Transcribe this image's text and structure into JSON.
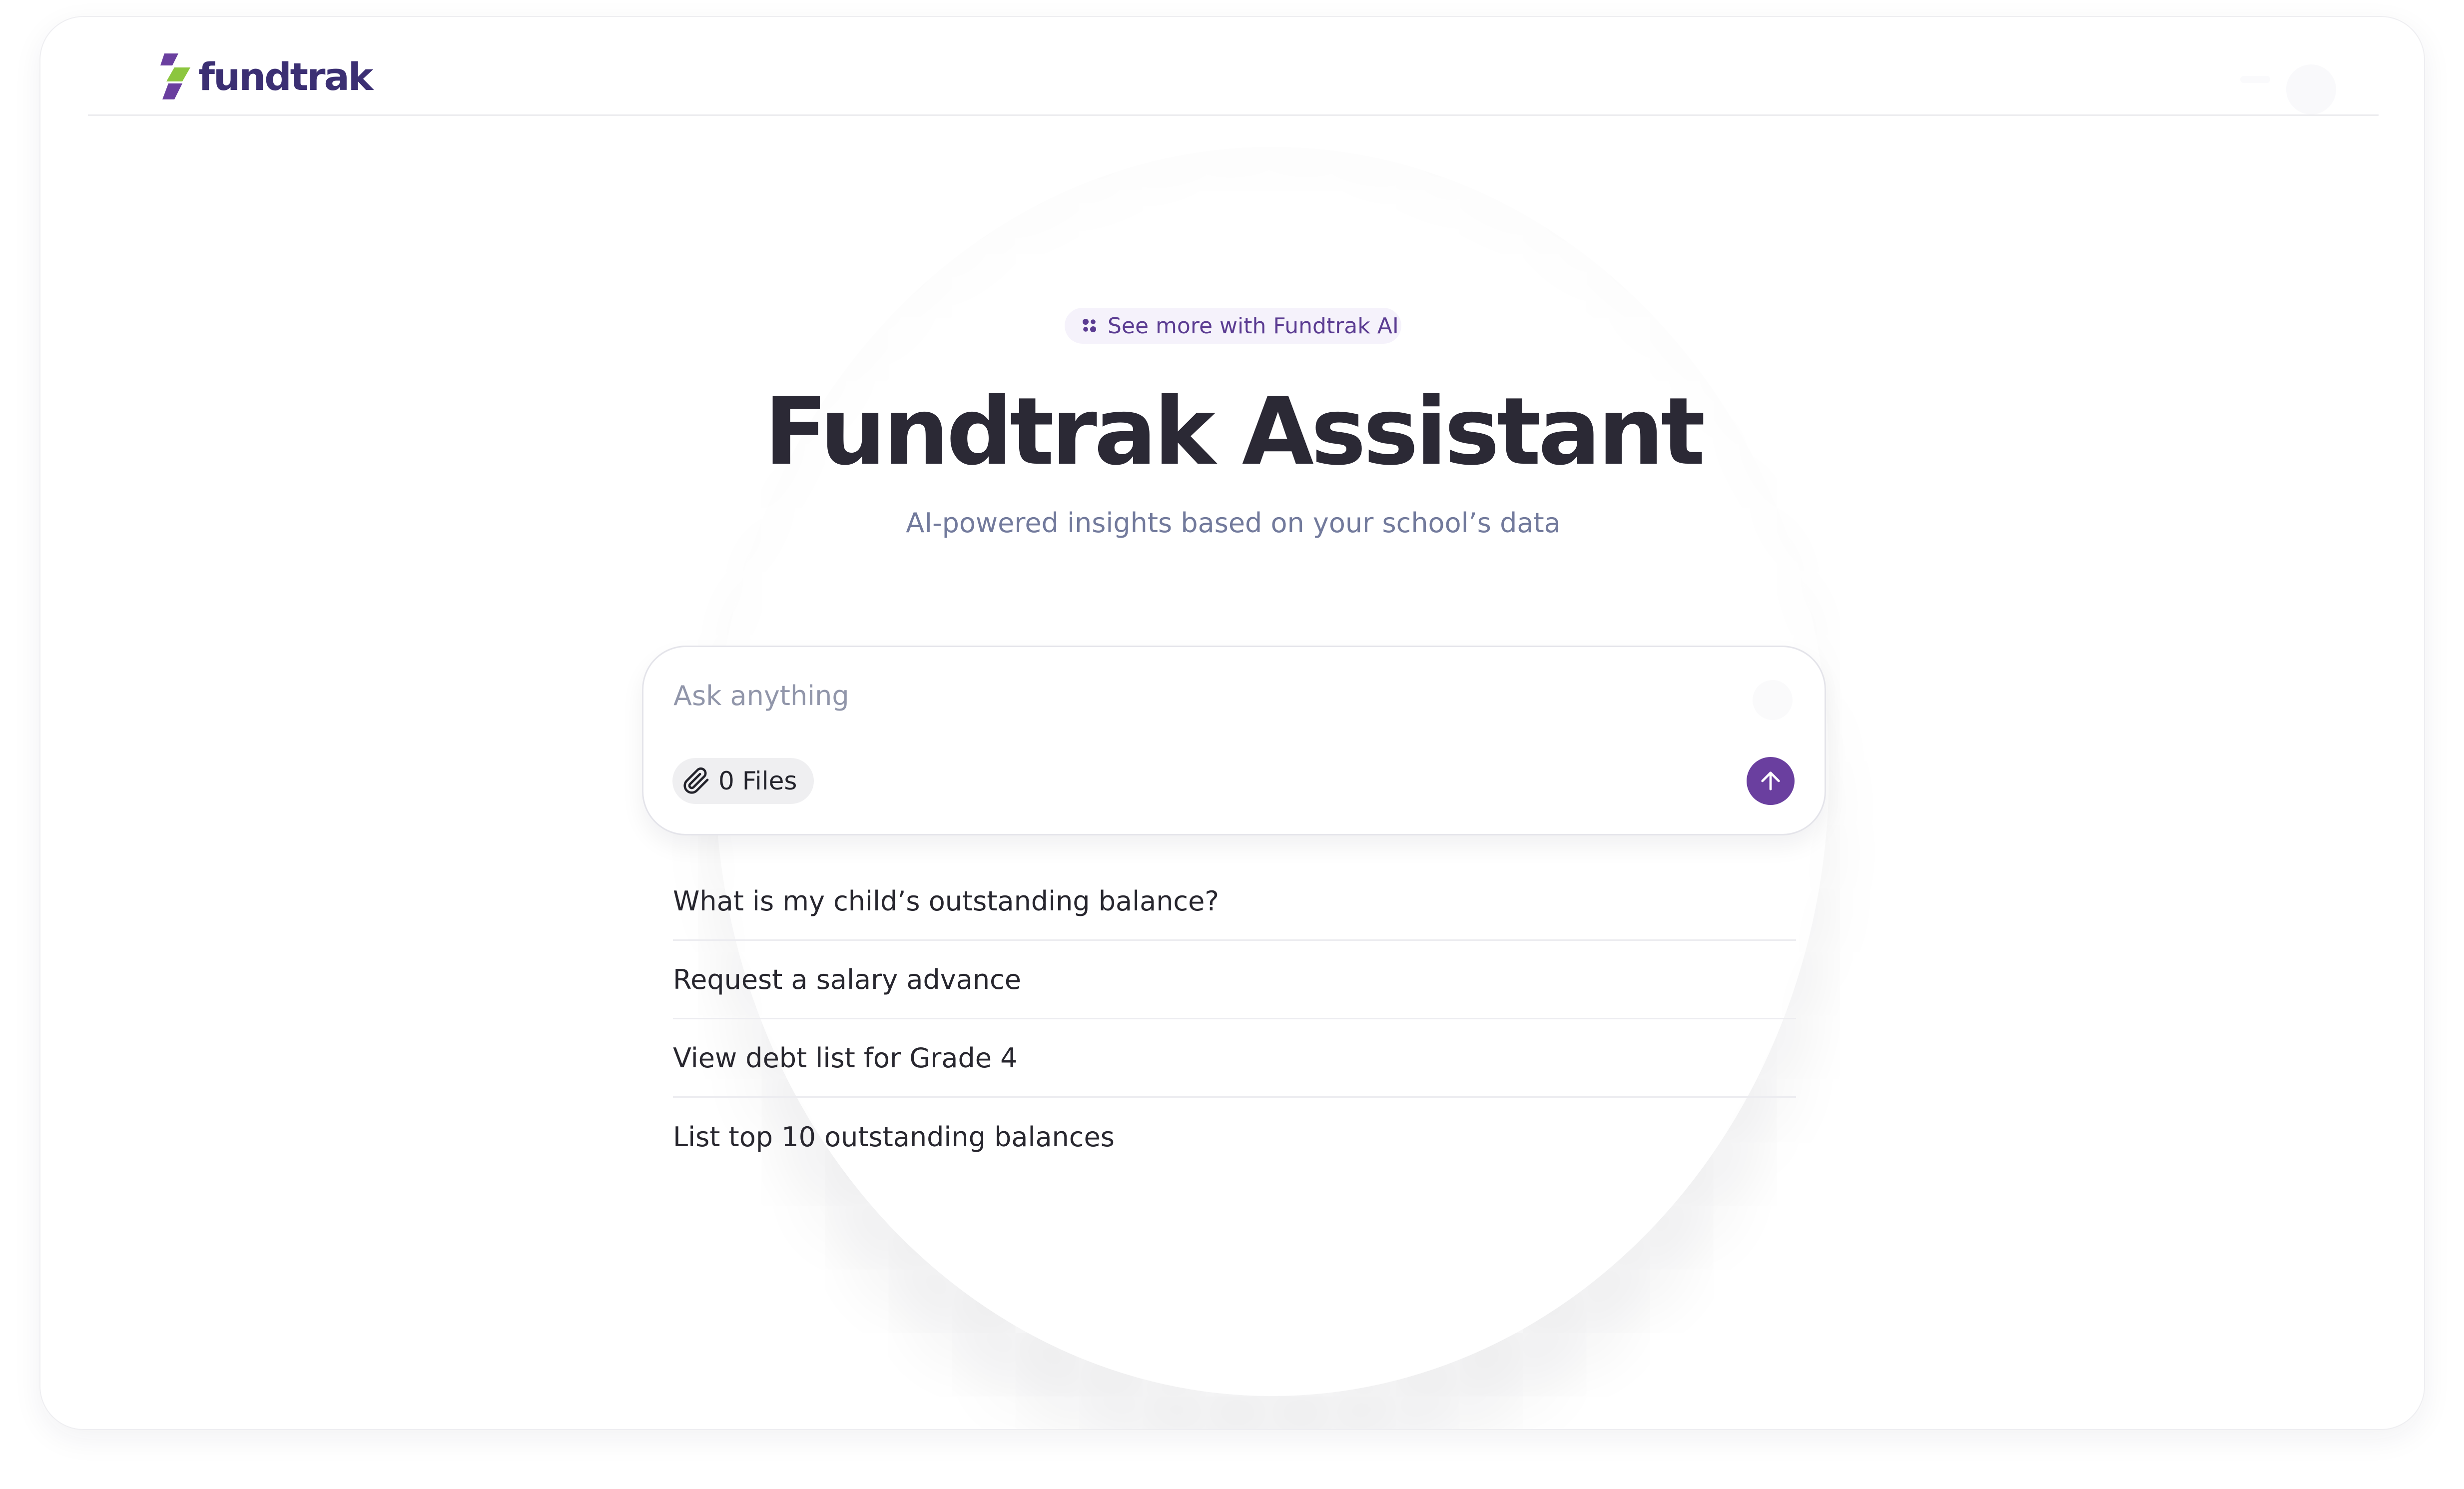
{
  "header": {
    "logo_text": "fundtrak"
  },
  "hero": {
    "badge_text": "See more with Fundtrak AI",
    "title": "Fundtrak Assistant",
    "subtitle": "AI-powered insights based on your school’s  data"
  },
  "composer": {
    "placeholder": "Ask anything",
    "value": "",
    "files_label": "0 Files"
  },
  "suggestions": [
    "What is my child’s outstanding balance?",
    "Request a salary advance",
    "View debt list for Grade 4",
    "List top 10 outstanding balances"
  ],
  "colors": {
    "brand_purple": "#3b2f73",
    "accent_purple": "#6a3f9f",
    "logo_green": "#8cc63f",
    "badge_bg": "#f5f2fb",
    "subtitle_gray": "#727a9c"
  },
  "icons": {
    "logo": "fundtrak-logo-icon",
    "badge": "sparkle-dots-icon",
    "files": "paperclip-icon",
    "send": "arrow-up-icon"
  }
}
